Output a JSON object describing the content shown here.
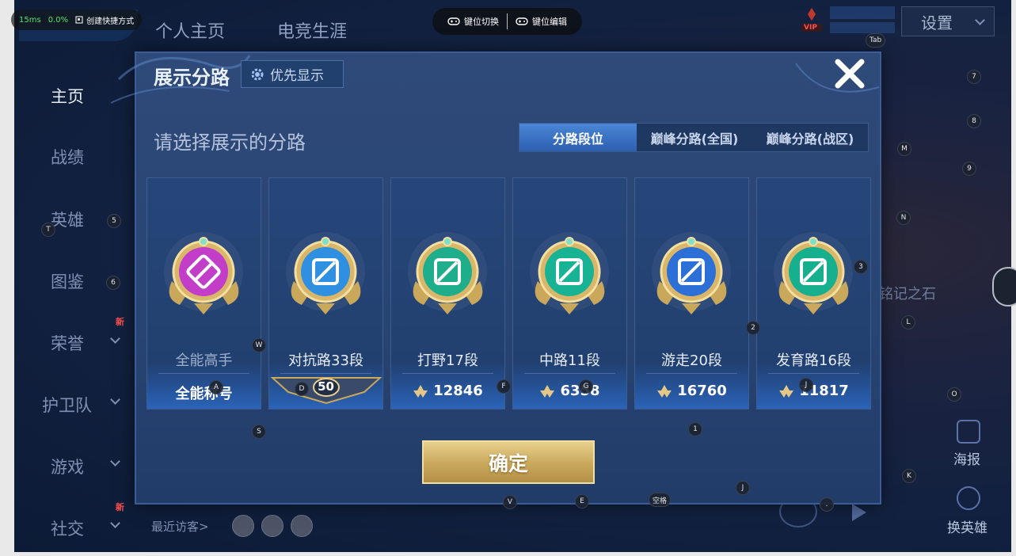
{
  "perf": {
    "ping": "15ms",
    "loss": "0.0%",
    "shortcut": "创建快捷方式"
  },
  "keybar": {
    "switch": "键位切换",
    "edit": "键位编辑"
  },
  "nav": {
    "home": "个人主页",
    "career": "电竞生涯"
  },
  "settings": "设置",
  "vip": "VIP",
  "sidebar": [
    {
      "label": "主页",
      "active": true
    },
    {
      "label": "战绩"
    },
    {
      "label": "英雄"
    },
    {
      "label": "图鉴"
    },
    {
      "label": "荣誉",
      "badge": "新"
    },
    {
      "label": "护卫队"
    },
    {
      "label": "游戏"
    },
    {
      "label": "社交",
      "badge": "新"
    }
  ],
  "right": {
    "stone": "铭记之石",
    "poster": "海报",
    "swap": "换英雄"
  },
  "visitor": "最近访客>",
  "dialog": {
    "title": "展示分路",
    "priority": "优先显示",
    "subtitle": "请选择展示的分路",
    "tabs": [
      "分路段位",
      "巅峰分路(全国)",
      "巅峰分路(战区)"
    ],
    "active_tab": 0,
    "cards": [
      {
        "name": "全能高手",
        "score": "全能称号",
        "color": "#c23ec8"
      },
      {
        "name": "对抗路33段",
        "score": "50",
        "color": "#2f8fe0"
      },
      {
        "name": "打野17段",
        "score": "12846",
        "color": "#1fae8c"
      },
      {
        "name": "中路11段",
        "score": "6358",
        "color": "#18b394"
      },
      {
        "name": "游走20段",
        "score": "16760",
        "color": "#2c6fd6"
      },
      {
        "name": "发育路16段",
        "score": "11817",
        "color": "#17b08e"
      }
    ],
    "confirm": "确定"
  },
  "keys": [
    {
      "k": "Tab"
    },
    {
      "k": "7"
    },
    {
      "k": "8"
    },
    {
      "k": "M"
    },
    {
      "k": "9"
    },
    {
      "k": "5"
    },
    {
      "k": "T"
    },
    {
      "k": "N"
    },
    {
      "k": "3"
    },
    {
      "k": "6"
    },
    {
      "k": "2"
    },
    {
      "k": "L"
    },
    {
      "k": "W"
    },
    {
      "k": "A"
    },
    {
      "k": "D"
    },
    {
      "k": "F"
    },
    {
      "k": "G"
    },
    {
      "k": "J"
    },
    {
      "k": "O"
    },
    {
      "k": "S"
    },
    {
      "k": "1"
    },
    {
      "k": "K"
    },
    {
      "k": "J"
    },
    {
      "k": "V"
    },
    {
      "k": "E"
    },
    {
      "k": "空格"
    },
    {
      "k": "."
    }
  ]
}
